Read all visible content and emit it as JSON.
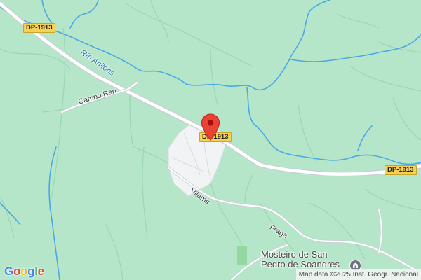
{
  "colors": {
    "land": "#b6e6c9",
    "built_area": "#f1f3f4",
    "road": "#ffffff",
    "road_casing": "#c8ced3",
    "minor_road": "#8fcfae",
    "water": "#4aa9e4",
    "shield_bg": "#f6d154",
    "marker": "#ea4335"
  },
  "road_shields": [
    "DP-1913",
    "DP-1913",
    "DP-1913"
  ],
  "labels": {
    "river": "Río Anllóns",
    "campo_ran": "Campo Ran",
    "vilamir": "Vilamir",
    "fraga": "Fraga"
  },
  "poi": {
    "name_line1": "Mosteiro de San",
    "name_line2": "Pedro de Soandres",
    "icon": "monastery-icon"
  },
  "marker": {
    "icon": "map-pin-icon"
  },
  "logo": {
    "text": [
      "G",
      "o",
      "o",
      "g",
      "l",
      "e"
    ],
    "colors": [
      "#4285f4",
      "#ea4335",
      "#fbbc05",
      "#4285f4",
      "#34a853",
      "#ea4335"
    ]
  },
  "attribution": "Map data ©2025 Inst. Geogr. Nacional"
}
